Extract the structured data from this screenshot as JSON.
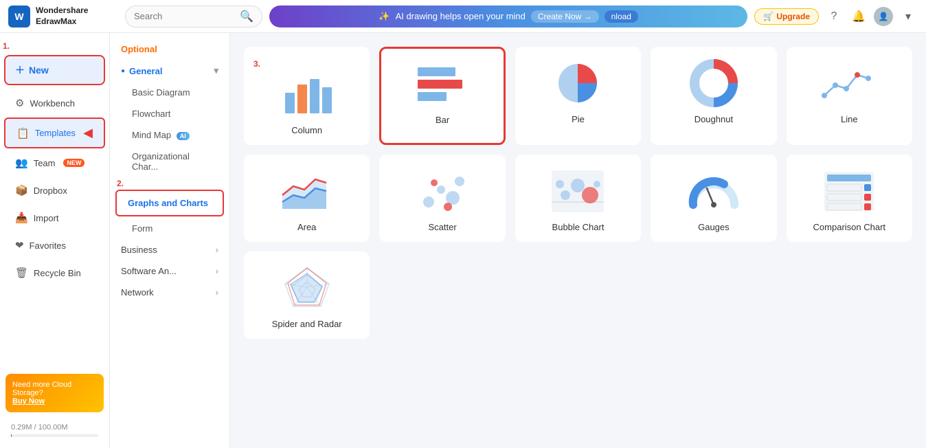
{
  "app": {
    "name": "Wondershare",
    "subtitle": "EdrawMax"
  },
  "topbar": {
    "search_placeholder": "Search",
    "ai_text": "AI drawing helps open your mind",
    "create_now": "Create Now →",
    "download": "nload",
    "upgrade": "Upgrade"
  },
  "sidebar": {
    "new_label": "New",
    "workbench_label": "Workbench",
    "templates_label": "Templates",
    "team_label": "Team",
    "dropbox_label": "Dropbox",
    "import_label": "Import",
    "favorites_label": "Favorites",
    "recycle_label": "Recycle Bin",
    "cloud_title": "Need more Cloud Storage?",
    "buy_now": "Buy Now",
    "storage_text": "0.29M / 100.00M"
  },
  "middle": {
    "optional_label": "Optional",
    "general_label": "General",
    "basic_diagram": "Basic Diagram",
    "flowchart": "Flowchart",
    "mind_map": "Mind Map",
    "org_chart": "Organizational Char...",
    "graphs_charts": "Graphs and Charts",
    "form": "Form",
    "business": "Business",
    "software_an": "Software An...",
    "network": "Network"
  },
  "charts": [
    {
      "name": "Column",
      "selected": false,
      "step3": true
    },
    {
      "name": "Bar",
      "selected": true,
      "step3": false
    },
    {
      "name": "Pie",
      "selected": false,
      "step3": false
    },
    {
      "name": "Doughnut",
      "selected": false,
      "step3": false
    },
    {
      "name": "Line",
      "selected": false,
      "step3": false
    },
    {
      "name": "Area",
      "selected": false,
      "step3": false
    },
    {
      "name": "Scatter",
      "selected": false,
      "step3": false
    },
    {
      "name": "Bubble Chart",
      "selected": false,
      "step3": false
    },
    {
      "name": "Gauges",
      "selected": false,
      "step3": false
    },
    {
      "name": "Comparison Chart",
      "selected": false,
      "step3": false
    },
    {
      "name": "Spider and Radar",
      "selected": false,
      "step3": false
    }
  ],
  "steps": {
    "step1": "1.",
    "step2": "2.",
    "step3": "3."
  }
}
